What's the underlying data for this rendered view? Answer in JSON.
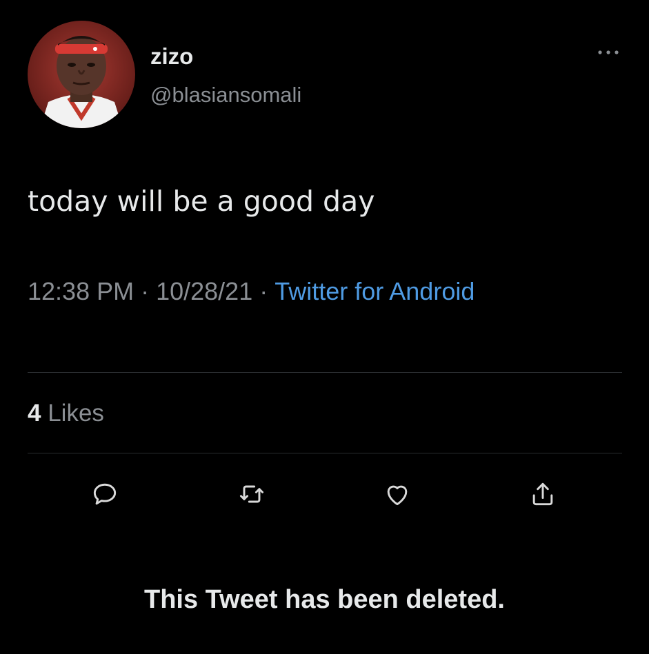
{
  "user": {
    "display_name": "zizo",
    "handle": "@blasiansomali",
    "avatar_icon": "user-avatar-photo"
  },
  "tweet": {
    "text": "today will be a good day",
    "time": "12:38 PM",
    "date": "10/28/21",
    "separator": "·",
    "source": "Twitter for Android"
  },
  "stats": {
    "likes_count": "4",
    "likes_label": "Likes"
  },
  "actions": {
    "reply_icon": "reply-icon",
    "retweet_icon": "retweet-icon",
    "like_icon": "heart-icon",
    "share_icon": "share-icon"
  },
  "notice": "This Tweet has been deleted.",
  "colors": {
    "background": "#000000",
    "primary_text": "#e7e9ea",
    "secondary_text": "#8b8f94",
    "link": "#4f9be3",
    "divider": "#2a2d30"
  }
}
